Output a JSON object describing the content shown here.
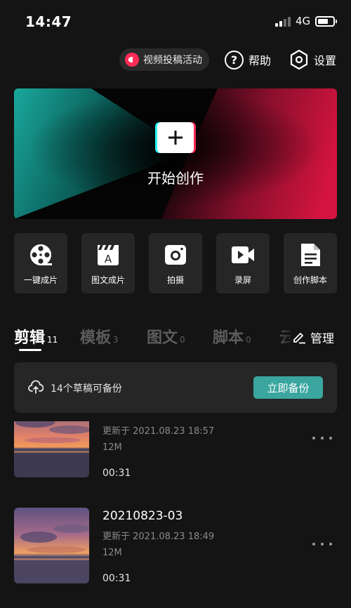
{
  "status_bar": {
    "time": "14:47",
    "network": "4G"
  },
  "header": {
    "promo_label": "视频投稿活动",
    "help_label": "帮助",
    "settings_label": "设置"
  },
  "hero": {
    "label": "开始创作"
  },
  "tools": [
    {
      "label": "一键成片",
      "icon": "film-reel-icon"
    },
    {
      "label": "图文成片",
      "icon": "text-clapper-icon"
    },
    {
      "label": "拍摄",
      "icon": "camera-icon"
    },
    {
      "label": "录屏",
      "icon": "video-camera-icon"
    },
    {
      "label": "创作脚本",
      "icon": "script-document-icon"
    }
  ],
  "tabs": [
    {
      "name": "剪辑",
      "count": "11",
      "active": true
    },
    {
      "name": "模板",
      "count": "3",
      "active": false
    },
    {
      "name": "图文",
      "count": "0",
      "active": false
    },
    {
      "name": "脚本",
      "count": "0",
      "active": false
    },
    {
      "name": "云",
      "count": "",
      "active": false
    }
  ],
  "manage_label": "管理",
  "backup": {
    "text": "14个草稿可备份",
    "button": "立即备份"
  },
  "drafts": [
    {
      "title": "",
      "updated": "更新于 2021.08.23 18:57",
      "size": "12M",
      "duration": "00:31"
    },
    {
      "title": "20210823-03",
      "updated": "更新于 2021.08.23 18:49",
      "size": "12M",
      "duration": "00:31"
    }
  ],
  "colors": {
    "background": "#141414",
    "card": "#262626",
    "accent_teal": "#3aa69f",
    "brand_red": "#fe2c55",
    "brand_cyan": "#25f4ee"
  }
}
